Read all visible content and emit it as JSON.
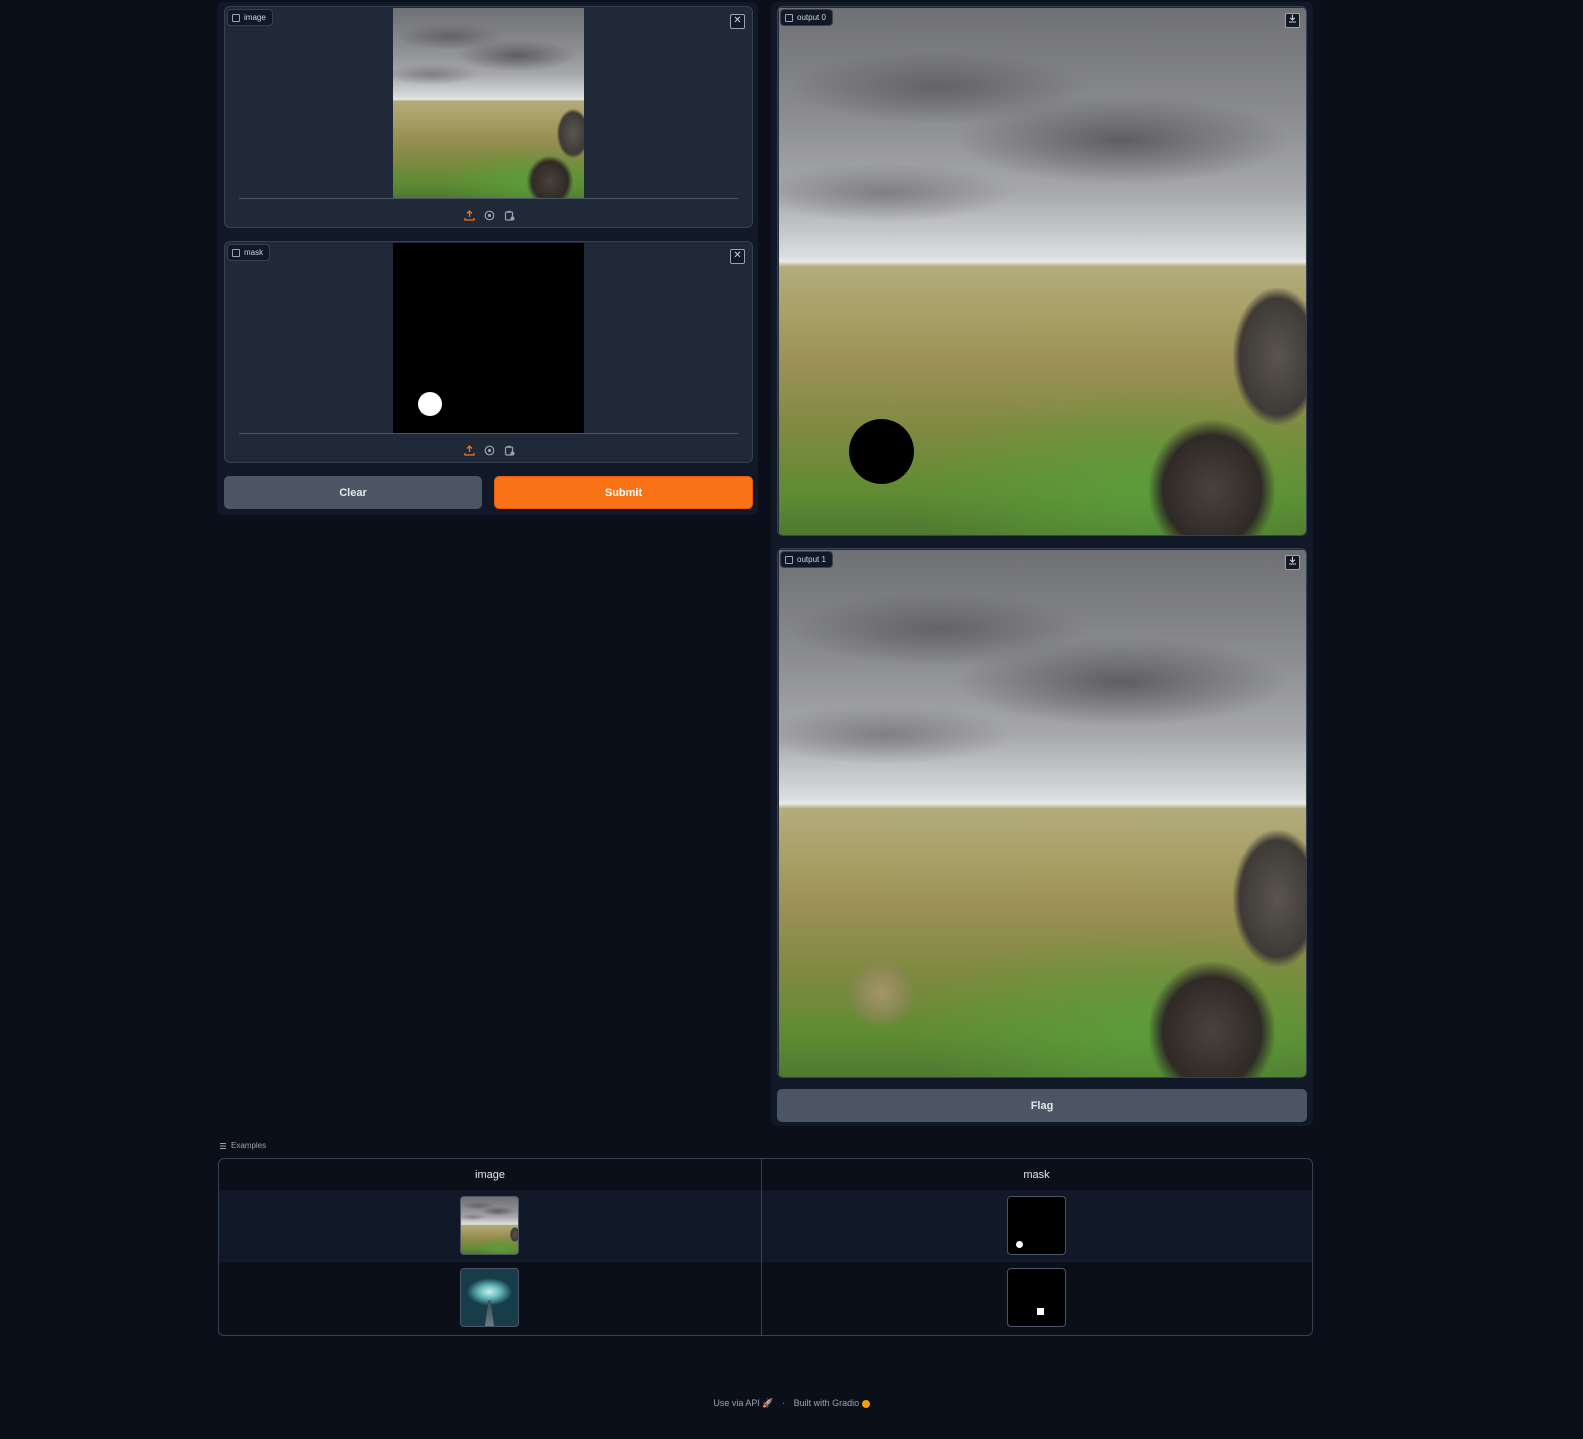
{
  "inputs": {
    "image": {
      "label": "image",
      "clear_icon": "close-icon"
    },
    "mask": {
      "label": "mask",
      "clear_icon": "close-icon"
    },
    "toolbar_icons": [
      "upload-icon",
      "webcam-icon",
      "clipboard-icon"
    ],
    "clear_label": "Clear",
    "submit_label": "Submit"
  },
  "outputs": {
    "output0": {
      "label": "output 0",
      "download_icon": "download-icon"
    },
    "output1": {
      "label": "output 1",
      "download_icon": "download-icon"
    },
    "flag_label": "Flag"
  },
  "examples": {
    "label": "Examples",
    "headers": [
      "image",
      "mask"
    ],
    "rows": [
      {
        "image": "landscape-thumbnail",
        "mask": "mask-dot-thumbnail"
      },
      {
        "image": "pier-thumbnail",
        "mask": "mask-square-thumbnail"
      }
    ]
  },
  "footer": {
    "api_label": "Use via API",
    "separator": "·",
    "built_with": "Built with Gradio"
  },
  "colors": {
    "background": "#0b0f19",
    "primary": "#f97316",
    "secondary": "#4b5563"
  }
}
